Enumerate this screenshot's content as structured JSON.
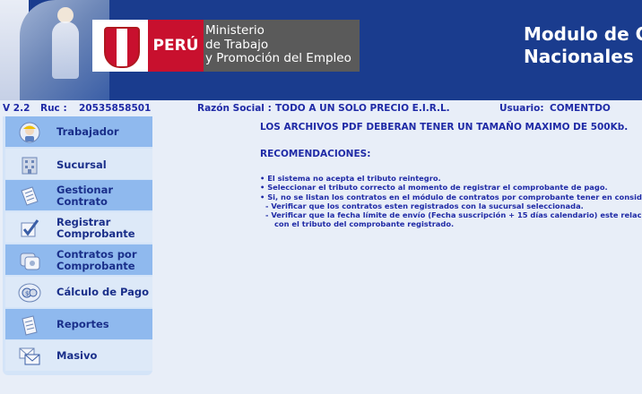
{
  "header": {
    "logo_country": "PERÚ",
    "ministry_lines": [
      "Ministerio",
      "de Trabajo",
      "y Promoción del Empleo"
    ],
    "title_lines": [
      "Modulo de C",
      "Nacionales"
    ]
  },
  "info": {
    "version": "V 2.2",
    "ruc_label": "Ruc :",
    "ruc_value": "20535858501",
    "razon_label": "Razón Social :",
    "razon_value": "TODO A UN SOLO PRECIO E.I.R.L.",
    "usuario_label": "Usuario:",
    "usuario_value": "COMENTDO"
  },
  "sidebar": {
    "items": [
      {
        "label_lines": [
          "Trabajador"
        ],
        "icon": "worker-icon"
      },
      {
        "label_lines": [
          "Sucursal"
        ],
        "icon": "building-icon"
      },
      {
        "label_lines": [
          "Gestionar",
          "Contrato"
        ],
        "icon": "document-icon"
      },
      {
        "label_lines": [
          "Registrar",
          "Comprobante"
        ],
        "icon": "checkmark-icon"
      },
      {
        "label_lines": [
          "Contratos por",
          "Comprobante"
        ],
        "icon": "contracts-icon"
      },
      {
        "label_lines": [
          "Cálculo de Pago"
        ],
        "icon": "coins-icon"
      },
      {
        "label_lines": [
          "Reportes"
        ],
        "icon": "report-icon"
      },
      {
        "label_lines": [
          "Masivo"
        ],
        "icon": "envelopes-icon"
      }
    ]
  },
  "main": {
    "notice": "LOS ARCHIVOS PDF DEBERAN TENER UN TAMAÑO MAXIMO DE 500Kb.",
    "recommendations_title": "RECOMENDACIONES:",
    "recommendations": [
      "• El sistema no acepta el tributo reintegro.",
      "• Seleccionar el tributo correcto al momento de registrar el comprobante de pago.",
      "• Si, no se listan los contratos en el módulo de contratos por comprobante tener en consid",
      "  - Verificar que los contratos esten registrados con la sucursal seleccionada.",
      "  - Verificar que la fecha límite de envío (Fecha suscripción + 15 días calendario) este relacio",
      "    con el tributo del comprobante registrado."
    ]
  },
  "colors": {
    "banner": "#1a3c8e",
    "text_blue": "#1f2aa6",
    "menu_blue": "#8fb9ee",
    "menu_light": "#dde9f8",
    "peru_red": "#c8102e"
  }
}
